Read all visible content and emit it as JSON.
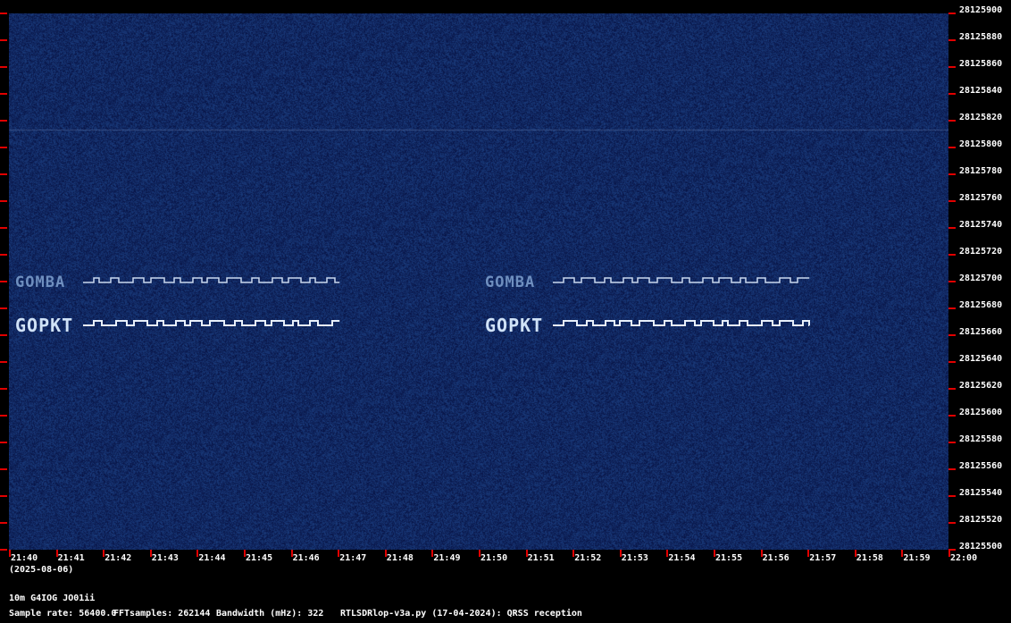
{
  "chart_data": {
    "type": "heatmap",
    "title": "RTLSDRlop-v3a.py (17-04-2024): QRSS reception",
    "x_ticks": [
      "21:40",
      "21:41",
      "21:42",
      "21:43",
      "21:44",
      "21:45",
      "21:46",
      "21:47",
      "21:48",
      "21:49",
      "21:50",
      "21:51",
      "21:52",
      "21:53",
      "21:54",
      "21:55",
      "21:56",
      "21:57",
      "21:58",
      "21:59",
      "22:00"
    ],
    "y_ticks": [
      "28125900",
      "28125880",
      "28125860",
      "28125840",
      "28125820",
      "28125800",
      "28125780",
      "28125760",
      "28125740",
      "28125720",
      "28125700",
      "28125680",
      "28125660",
      "28125640",
      "28125620",
      "28125600",
      "28125580",
      "28125560",
      "28125540",
      "28125520",
      "28125500"
    ],
    "xlim": [
      "21:40",
      "22:00"
    ],
    "ylim": [
      28125500,
      28125900
    ],
    "signals": [
      {
        "callsign": "GOMBA",
        "start": "21:40",
        "end": "21:47",
        "freq": 28125700
      },
      {
        "callsign": "GOPKT",
        "start": "21:40",
        "end": "21:47",
        "freq": 28125668
      },
      {
        "callsign": "GOMBA",
        "start": "21:50",
        "end": "21:57",
        "freq": 28125700
      },
      {
        "callsign": "GOPKT",
        "start": "21:50",
        "end": "21:57",
        "freq": 28125668
      }
    ],
    "colors": {
      "background": "#0a1a4f",
      "signal": "#a8c4e6",
      "tick": "#e00000"
    }
  },
  "footer": {
    "date": "(2025-08-06)",
    "station": "10m G4IOG JO01ii",
    "sample_rate": "Sample rate: 56400.0",
    "fft_samples": "FFTsamples: 262144",
    "bandwidth": "Bandwidth (mHz): 322",
    "program": "RTLSDRlop-v3a.py (17-04-2024): QRSS reception"
  }
}
